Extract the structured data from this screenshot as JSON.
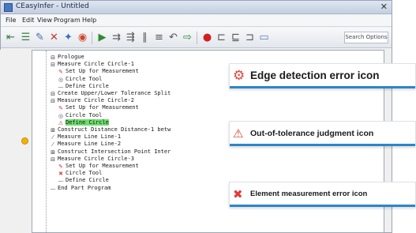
{
  "window": {
    "title": "CEasyInfer - Untitled"
  },
  "menu": [
    "File",
    "Edit",
    "View",
    "Program",
    "Help"
  ],
  "toolbar": {
    "search_options": "Search Options"
  },
  "tree": [
    {
      "icon": "⊟",
      "icon_name": "program-node-icon",
      "text": "Prologue",
      "indent": 0,
      "color": "#333"
    },
    {
      "icon": "⊟",
      "icon_name": "measure-circle-icon",
      "text": "Measure Circle Circle-1",
      "indent": 0,
      "color": "#333"
    },
    {
      "icon": "✎",
      "icon_name": "setup-icon",
      "text": "Set Up for Measurement",
      "indent": 1,
      "color": "#c0392b"
    },
    {
      "icon": "◎",
      "icon_name": "circle-tool-icon",
      "text": "Circle Tool",
      "indent": 1,
      "color": "#556"
    },
    {
      "icon": "—",
      "icon_name": "define-icon",
      "text": "Define Circle",
      "indent": 1,
      "color": "#556"
    },
    {
      "icon": "⊟",
      "icon_name": "tolerance-icon",
      "text": "Create Upper/Lower Tolerance Split",
      "indent": 0,
      "color": "#333"
    },
    {
      "icon": "⊟",
      "icon_name": "measure-circle-icon",
      "text": "Measure Circle Circle-2",
      "indent": 0,
      "color": "#333"
    },
    {
      "icon": "✎",
      "icon_name": "setup-icon",
      "text": "Set Up for Measurement",
      "indent": 1,
      "color": "#c0392b"
    },
    {
      "icon": "◎",
      "icon_name": "circle-tool-icon",
      "text": "Circle Tool",
      "indent": 1,
      "color": "#556"
    },
    {
      "icon": "⚠",
      "icon_name": "out-of-tolerance-icon",
      "text": "Define Circle",
      "indent": 1,
      "color": "#c0392b",
      "selected": true
    },
    {
      "icon": "⊞",
      "icon_name": "distance-icon",
      "text": "Construct Distance Distance-1 betw",
      "indent": 0,
      "color": "#333"
    },
    {
      "icon": "⁄",
      "icon_name": "measure-line-icon",
      "text": "Measure Line Line-1",
      "indent": 0,
      "color": "#3a5fb0"
    },
    {
      "icon": "⁄",
      "icon_name": "measure-line-icon",
      "text": "Measure Line Line-2",
      "indent": 0,
      "color": "#3a5fb0"
    },
    {
      "icon": "⊞",
      "icon_name": "intersection-icon",
      "text": "Construct Intersection Point Inter",
      "indent": 0,
      "color": "#333"
    },
    {
      "icon": "⊟",
      "icon_name": "measure-circle-icon",
      "text": "Measure Circle Circle-3",
      "indent": 0,
      "color": "#333"
    },
    {
      "icon": "✎",
      "icon_name": "setup-icon",
      "text": "Set Up for Measurement",
      "indent": 1,
      "color": "#c0392b"
    },
    {
      "icon": "✖",
      "icon_name": "edge-detection-error-icon",
      "text": "Circle Tool",
      "indent": 1,
      "color": "#d9534f"
    },
    {
      "icon": "—",
      "icon_name": "define-icon",
      "text": "Define Circle",
      "indent": 1,
      "color": "#556"
    },
    {
      "icon": "—",
      "icon_name": "end-program-icon",
      "text": "End Part Program",
      "indent": 0,
      "color": "#556"
    }
  ],
  "callouts": [
    {
      "label": "Edge detection error icon",
      "icon_name": "edge-detection-error-icon",
      "icon_color": "#e0453a"
    },
    {
      "label": "Out-of-tolerance judgment icon",
      "icon_name": "out-of-tolerance-icon",
      "icon_color": "#d9442e"
    },
    {
      "label": "Element measurement error icon",
      "icon_name": "element-measurement-error-icon",
      "icon_color": "#e23b3b"
    }
  ]
}
